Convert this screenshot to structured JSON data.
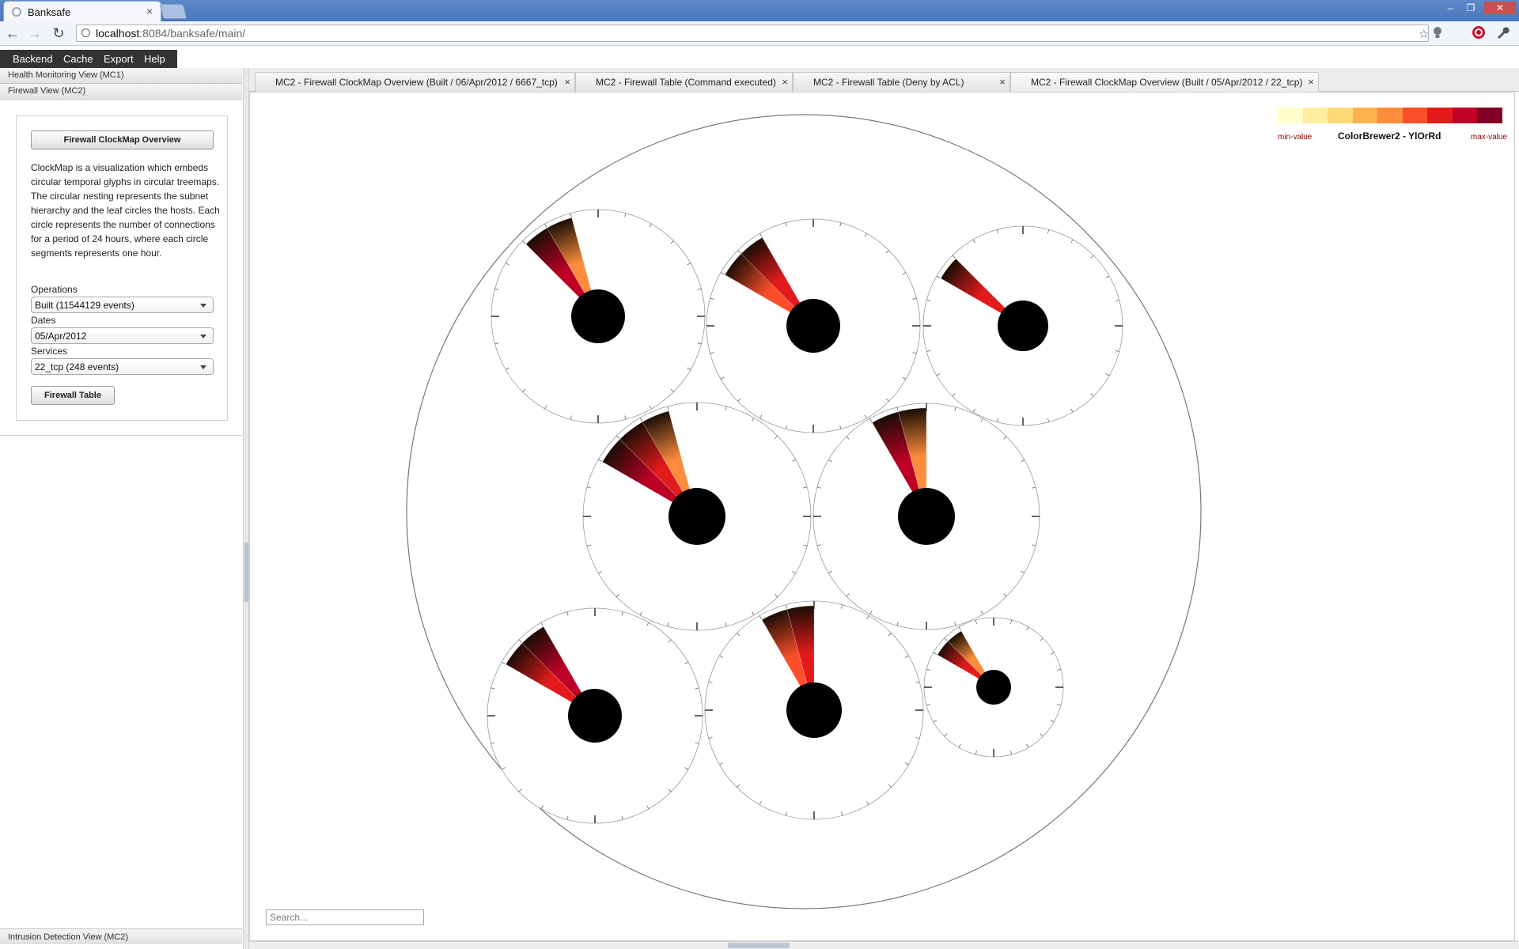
{
  "browser": {
    "tab_title": "Banksafe",
    "tab_close": "×",
    "url_host": "localhost",
    "url_rest": ":8084/banksafe/main/",
    "window_controls": [
      "–",
      "❐",
      "✕"
    ]
  },
  "menu": [
    "Backend",
    "Cache",
    "Export",
    "Help"
  ],
  "left_panel": {
    "sections": [
      "Health Monitoring View (MC1)",
      "Firewall View (MC2)"
    ],
    "overview_button": "Firewall ClockMap Overview",
    "description": "ClockMap is a visualization which embeds circular temporal glyphs in circular treemaps. The circular nesting represents the subnet hierarchy and the leaf circles the hosts. Each circle represents the number of connections for a period of 24 hours, where each circle segments represents one hour.",
    "operations_label": "Operations",
    "operations_value": "Built (11544129 events)",
    "dates_label": "Dates",
    "dates_value": "05/Apr/2012",
    "services_label": "Services",
    "services_value": "22_tcp (248 events)",
    "table_button": "Firewall Table",
    "bottom_section": "Intrusion Detection View (MC2)"
  },
  "content_tabs": [
    {
      "label": "MC2 - Firewall ClockMap Overview (Built / 06/Apr/2012 / 6667_tcp)",
      "close": "×"
    },
    {
      "label": "MC2 - Firewall Table (Command executed)",
      "close": "×"
    },
    {
      "label": "MC2 - Firewall Table (Deny by ACL)",
      "close": "×"
    },
    {
      "label": "MC2 - Firewall ClockMap Overview (Built / 05/Apr/2012 / 22_tcp)",
      "close": "×"
    }
  ],
  "legend": {
    "name": "ColorBrewer2 - YlOrRd",
    "min_label": "min-value",
    "max_label": "max-value",
    "colors": [
      "#ffffcc",
      "#ffeda0",
      "#fed976",
      "#feb24c",
      "#fd8d3c",
      "#fc4e2a",
      "#e31a1c",
      "#bd0026",
      "#800026"
    ]
  },
  "search": {
    "placeholder": "Search..."
  },
  "clockmap": {
    "hosts": [
      {
        "id": "host-1",
        "hours": [
          21,
          22
        ],
        "intensity": [
          0.85,
          0.45
        ]
      },
      {
        "id": "host-2",
        "hours": [
          20,
          21
        ],
        "intensity": [
          0.6,
          0.8
        ]
      },
      {
        "id": "host-3",
        "hours": [
          20
        ],
        "intensity": [
          0.75
        ]
      },
      {
        "id": "host-4",
        "hours": [
          20,
          21,
          22
        ],
        "intensity": [
          0.9,
          0.7,
          0.55
        ]
      },
      {
        "id": "host-5",
        "hours": [
          22,
          23
        ],
        "intensity": [
          0.85,
          0.5
        ]
      },
      {
        "id": "host-6",
        "hours": [
          20,
          21
        ],
        "intensity": [
          0.8,
          0.9
        ]
      },
      {
        "id": "host-7",
        "hours": [
          22,
          23
        ],
        "intensity": [
          0.6,
          0.8
        ]
      },
      {
        "id": "host-8",
        "hours": [
          20,
          21
        ],
        "intensity": [
          0.7,
          0.5
        ]
      }
    ]
  }
}
